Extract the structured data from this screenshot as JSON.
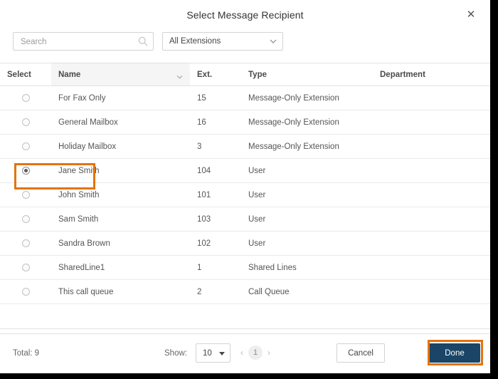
{
  "dialog": {
    "title": "Select Message Recipient",
    "close_icon": "close-icon"
  },
  "filters": {
    "search_placeholder": "Search",
    "search_value": "",
    "search_icon": "search-icon",
    "extension_filter_value": "All Extensions",
    "extension_filter_icon": "chevron-down-icon"
  },
  "table": {
    "columns": [
      {
        "key": "select",
        "label": "Select"
      },
      {
        "key": "name",
        "label": "Name"
      },
      {
        "key": "ext",
        "label": "Ext."
      },
      {
        "key": "type",
        "label": "Type"
      },
      {
        "key": "department",
        "label": "Department"
      }
    ],
    "sorted_column": "Name",
    "sort_icon": "chevron-down-icon",
    "rows": [
      {
        "selected": false,
        "name": "For Fax Only",
        "ext": "15",
        "type": "Message-Only Extension",
        "department": ""
      },
      {
        "selected": false,
        "name": "General Mailbox",
        "ext": "16",
        "type": "Message-Only Extension",
        "department": ""
      },
      {
        "selected": false,
        "name": "Holiday Mailbox",
        "ext": "3",
        "type": "Message-Only Extension",
        "department": ""
      },
      {
        "selected": true,
        "name": "Jane Smith",
        "ext": "104",
        "type": "User",
        "department": ""
      },
      {
        "selected": false,
        "name": "John Smith",
        "ext": "101",
        "type": "User",
        "department": ""
      },
      {
        "selected": false,
        "name": "Sam Smith",
        "ext": "103",
        "type": "User",
        "department": ""
      },
      {
        "selected": false,
        "name": "Sandra Brown",
        "ext": "102",
        "type": "User",
        "department": ""
      },
      {
        "selected": false,
        "name": "SharedLine1",
        "ext": "1",
        "type": "Shared Lines",
        "department": ""
      },
      {
        "selected": false,
        "name": "This call queue",
        "ext": "2",
        "type": "Call Queue",
        "department": ""
      }
    ]
  },
  "footer": {
    "total_label": "Total: 9",
    "show_label": "Show:",
    "page_size": "10",
    "prev_icon": "chevron-left-icon",
    "next_icon": "chevron-right-icon",
    "current_page": "1",
    "cancel_label": "Cancel",
    "done_label": "Done"
  },
  "annotations": {
    "highlight_color": "#e2740c",
    "targets": [
      "selected-row-jane-smith",
      "done-button"
    ]
  }
}
